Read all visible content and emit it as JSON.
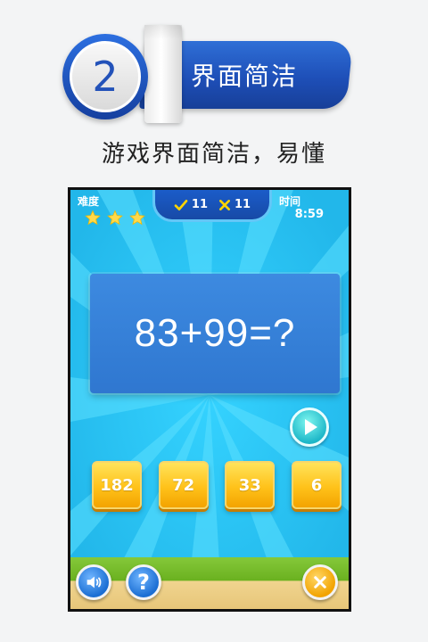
{
  "header": {
    "step_number": "2",
    "ribbon_title": "界面简洁"
  },
  "subtitle": "游戏界面简洁，易懂",
  "game": {
    "difficulty_label": "难度",
    "difficulty_stars": 3,
    "correct_count": "11",
    "wrong_count": "11",
    "time_label": "时间",
    "time_value": "8:59",
    "question": "83+99=?",
    "answers": [
      "182",
      "72",
      "33",
      "6"
    ]
  },
  "colors": {
    "accent_blue": "#1e4fb8",
    "sky_blue": "#2cc5f3",
    "answer_yellow": "#ffc21a",
    "correct_yellow": "#ffd400"
  },
  "icons": {
    "play": "play-icon",
    "sound": "speaker-icon",
    "help": "question-mark-icon",
    "close": "close-icon",
    "check": "check-icon",
    "cross": "cross-icon",
    "star": "star-icon"
  }
}
